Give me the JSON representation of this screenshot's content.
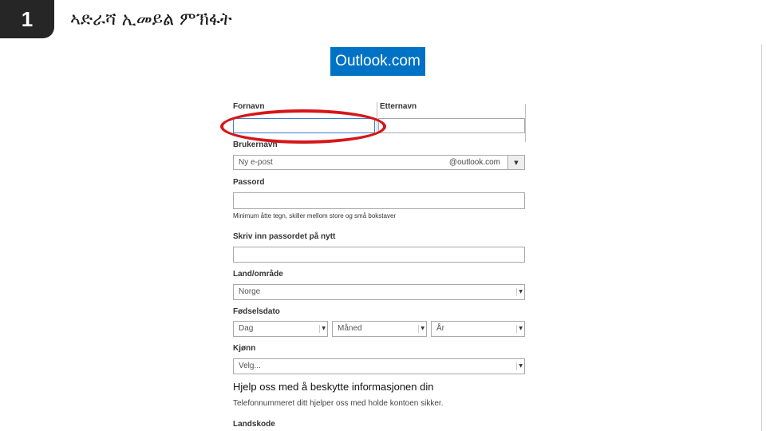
{
  "slide": {
    "step_number": "1",
    "title": "ኣድራሻ ኢመይል ምኽፋት"
  },
  "logo": {
    "text": "Outlook.com"
  },
  "form": {
    "first_name_label": "Fornavn",
    "last_name_label": "Etternavn",
    "username_label": "Brukernavn",
    "username_placeholder": "Ny e-post",
    "domain_suffix": "@outlook.com",
    "password_label": "Passord",
    "password_hint": "Minimum åtte tegn, skiller mellom store og små bokstaver",
    "password_repeat_label": "Skriv inn passordet på nytt",
    "country_label": "Land/område",
    "country_value": "Norge",
    "birthdate_label": "Fødselsdato",
    "day_value": "Dag",
    "month_value": "Måned",
    "year_value": "År",
    "gender_label": "Kjønn",
    "gender_value": "Velg...",
    "help_heading": "Hjelp oss med å beskytte informasjonen din",
    "help_sub": "Telefonnummeret ditt hjelper oss med holde kontoen sikker.",
    "country_code_label": "Landskode"
  },
  "colors": {
    "brand": "#0072c6",
    "highlight": "#d6161a",
    "badge": "#262626"
  }
}
